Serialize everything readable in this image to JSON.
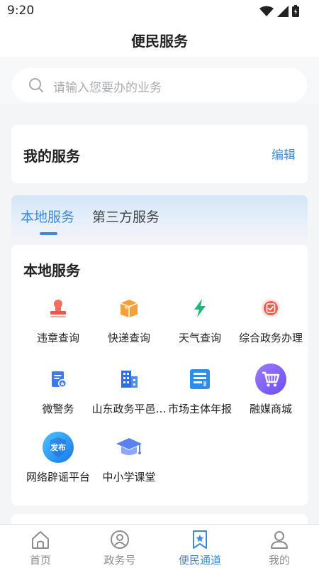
{
  "status_bar": {
    "time": "9:20"
  },
  "header": {
    "title": "便民服务"
  },
  "search": {
    "placeholder": "请输入您要办的业务"
  },
  "my_services": {
    "title": "我的服务",
    "edit_label": "编辑"
  },
  "tabs": [
    {
      "label": "本地服务",
      "active": true
    },
    {
      "label": "第三方服务",
      "active": false
    }
  ],
  "local_services": {
    "title": "本地服务",
    "items": [
      {
        "label": "违章查询",
        "icon": "seal-stamp-icon"
      },
      {
        "label": "快递查询",
        "icon": "package-box-icon"
      },
      {
        "label": "天气查询",
        "icon": "lightning-icon"
      },
      {
        "label": "综合政务办理",
        "icon": "shield-check-icon"
      },
      {
        "label": "微警务",
        "icon": "police-document-icon"
      },
      {
        "label": "山东政务平邑…",
        "icon": "government-building-icon"
      },
      {
        "label": "市场主体年报",
        "icon": "report-document-icon"
      },
      {
        "label": "融媒商城",
        "icon": "shopping-cart-icon"
      },
      {
        "label": "网络辟谣平台",
        "icon": "publish-shield-icon",
        "badge": "发布"
      },
      {
        "label": "中小学课堂",
        "icon": "graduation-cap-icon"
      }
    ]
  },
  "tabbar": [
    {
      "label": "首页",
      "icon": "home-icon",
      "active": false
    },
    {
      "label": "政务号",
      "icon": "government-account-icon",
      "active": false
    },
    {
      "label": "便民通道",
      "icon": "bookmark-star-icon",
      "active": true
    },
    {
      "label": "我的",
      "icon": "profile-icon",
      "active": false
    }
  ],
  "colors": {
    "accent": "#3d8bd8",
    "background": "#f4f5f7",
    "card": "#ffffff"
  }
}
